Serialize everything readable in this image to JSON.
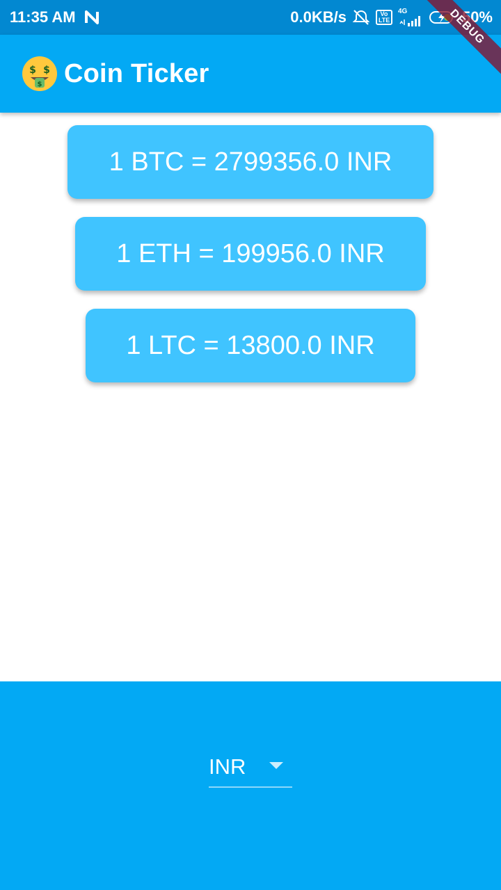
{
  "status_bar": {
    "time": "11:35 AM",
    "network_speed": "0.0KB/s",
    "signal_type": "4G",
    "volte_top": "Vo",
    "volte_bottom": "LTE",
    "battery": "50%"
  },
  "debug_banner": "DEBUG",
  "app_bar": {
    "icon": "money-mouth-face-icon",
    "title": "Coin Ticker"
  },
  "rates": [
    {
      "text": "1 BTC = 2799356.0 INR"
    },
    {
      "text": "1 ETH = 199956.0 INR"
    },
    {
      "text": "1 LTC = 13800.0 INR"
    }
  ],
  "currency_picker": {
    "selected": "INR",
    "icon": "arrow-drop-down-icon"
  },
  "colors": {
    "status_bar": "#0288D1",
    "primary": "#03A9F4",
    "card": "#40C4FF"
  }
}
